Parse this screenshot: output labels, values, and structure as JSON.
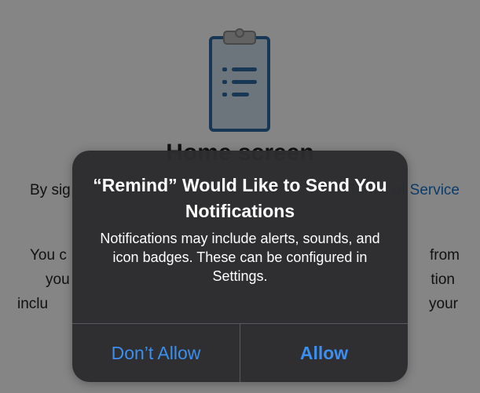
{
  "background": {
    "heading": "Home screen",
    "terms_prefix": "By sig",
    "terms_link": "Terms of Service",
    "body_rows": [
      {
        "left": "You c",
        "right": "from"
      },
      {
        "left": "you",
        "right": "tion"
      },
      {
        "left": "inclu",
        "right": "your"
      }
    ]
  },
  "alert": {
    "title": "“Remind” Would Like to Send You Notifications",
    "message": "Notifications may include alerts, sounds, and icon badges. These can be configured in Settings.",
    "deny_label": "Don’t Allow",
    "allow_label": "Allow"
  },
  "colors": {
    "link_blue": "#1a73c9",
    "alert_button_blue": "#3a8ff0",
    "clipboard_blue": "#2d6aa3"
  },
  "icons": [
    "clipboard-list-icon"
  ]
}
